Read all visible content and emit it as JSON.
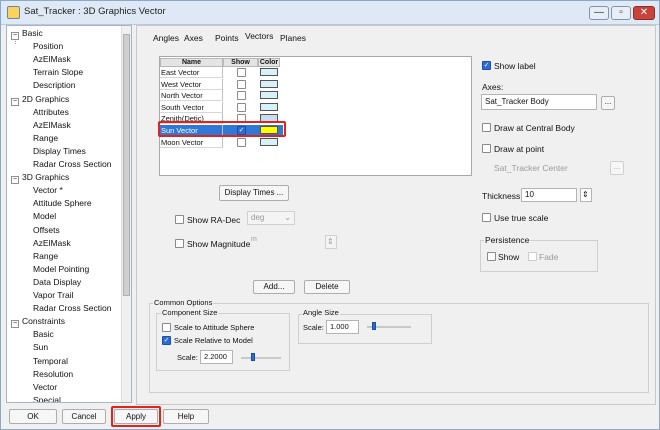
{
  "window": {
    "title": "Sat_Tracker : 3D Graphics Vector"
  },
  "window_controls": {
    "minimize": "—",
    "restore": "▫",
    "close": "✕"
  },
  "tree": {
    "items": [
      {
        "label": "Basic",
        "level": 0,
        "expander": "−"
      },
      {
        "label": "Position",
        "level": 1
      },
      {
        "label": "AzElMask",
        "level": 1
      },
      {
        "label": "Terrain Slope",
        "level": 1
      },
      {
        "label": "Description",
        "level": 1
      },
      {
        "label": "2D Graphics",
        "level": 0,
        "expander": "−"
      },
      {
        "label": "Attributes",
        "level": 1
      },
      {
        "label": "AzElMask",
        "level": 1
      },
      {
        "label": "Range",
        "level": 1
      },
      {
        "label": "Display Times",
        "level": 1
      },
      {
        "label": "Radar Cross Section",
        "level": 1
      },
      {
        "label": "3D Graphics",
        "level": 0,
        "expander": "−"
      },
      {
        "label": "Vector *",
        "level": 1,
        "selected": true
      },
      {
        "label": "Attitude Sphere",
        "level": 1
      },
      {
        "label": "Model",
        "level": 1
      },
      {
        "label": "Offsets",
        "level": 1
      },
      {
        "label": "AzElMask",
        "level": 1
      },
      {
        "label": "Range",
        "level": 1
      },
      {
        "label": "Model Pointing",
        "level": 1
      },
      {
        "label": "Data Display",
        "level": 1
      },
      {
        "label": "Vapor Trail",
        "level": 1
      },
      {
        "label": "Radar Cross Section",
        "level": 1
      },
      {
        "label": "Constraints",
        "level": 0,
        "expander": "−"
      },
      {
        "label": "Basic",
        "level": 1
      },
      {
        "label": "Sun",
        "level": 1
      },
      {
        "label": "Temporal",
        "level": 1
      },
      {
        "label": "Resolution",
        "level": 1
      },
      {
        "label": "Vector",
        "level": 1
      },
      {
        "label": "Special",
        "level": 1
      }
    ]
  },
  "tabs": [
    "Angles",
    "Axes",
    "Points",
    "Vectors",
    "Planes"
  ],
  "active_tab": "Vectors",
  "vector_table": {
    "headers": [
      "Name",
      "Show",
      "Color"
    ],
    "rows": [
      {
        "name": "East Vector",
        "show": false,
        "color": "#d8f0f8"
      },
      {
        "name": "West Vector",
        "show": false,
        "color": "#d8f0f8"
      },
      {
        "name": "North Vector",
        "show": false,
        "color": "#d8f0f8"
      },
      {
        "name": "South Vector",
        "show": false,
        "color": "#d8f0f8"
      },
      {
        "name": "Zenith(Detic) Vector",
        "show": false,
        "color": "#c8dcf0"
      },
      {
        "name": "Sun Vector",
        "show": true,
        "color": "#ffff00",
        "selected": true
      },
      {
        "name": "Moon Vector",
        "show": false,
        "color": "#d8f0f8"
      }
    ]
  },
  "display_times_button": "Display Times ...",
  "show_ra_dec": {
    "label": "Show RA-Dec",
    "unit": "deg"
  },
  "show_magnitude": {
    "label": "Show Magnitude",
    "unit": "m",
    "stepper": "⇕"
  },
  "right_panel": {
    "show_label": "Show label",
    "axes_label": "Axes:",
    "axes_value": "Sat_Tracker Body",
    "browse": "...",
    "draw_central_body": "Draw at Central Body",
    "draw_at_point": "Draw at point",
    "point_value": "Sat_Tracker Center",
    "thickness_label": "Thickness:",
    "thickness_value": "10",
    "thickness_stepper": "⇕",
    "use_true_scale": "Use true scale",
    "persistence_title": "Persistence",
    "persistence_show": "Show",
    "persistence_fade": "Fade"
  },
  "add_button": "Add...",
  "delete_button": "Delete",
  "common_options": {
    "title": "Common Options",
    "component_size": "Component Size",
    "scale_to_attitude_sphere": "Scale to Attitude Sphere",
    "scale_relative_to_model": "Scale Relative to Model",
    "scale_label": "Scale:",
    "scale_value": "2.2000",
    "scale_level": 0.3,
    "angle_size": "Angle Size",
    "angle_scale_label": "Scale:",
    "angle_scale_value": "1.000",
    "angle_scale_level": 0.15
  },
  "bottom_buttons": {
    "ok": "OK",
    "cancel": "Cancel",
    "apply": "Apply",
    "help": "Help"
  },
  "colors": {
    "accent": "#2a6bd8",
    "highlight_box": "#e0241c",
    "selection": "#3078d8"
  }
}
